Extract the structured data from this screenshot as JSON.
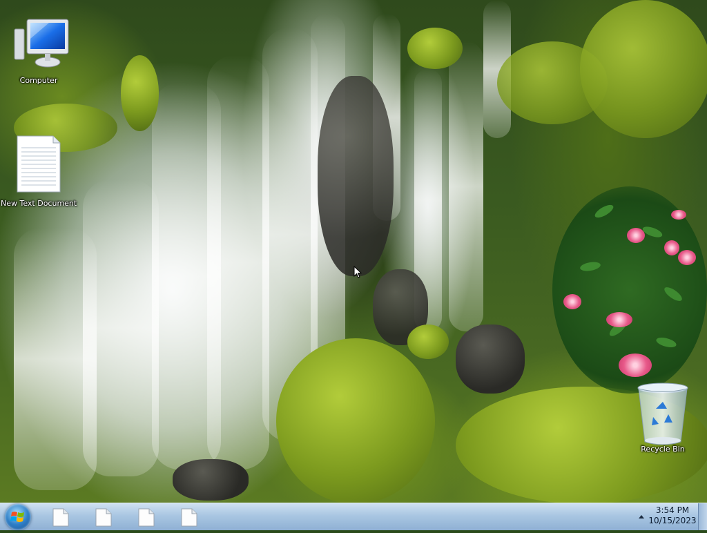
{
  "desktop": {
    "icons": [
      {
        "label": "Computer",
        "icon": "computer-icon"
      },
      {
        "label": "New Text Document",
        "icon": "text-document-icon"
      },
      {
        "label": "Recycle Bin",
        "icon": "recycle-bin-icon"
      }
    ]
  },
  "taskbar": {
    "start_button": {
      "icon": "windows-start-orb-icon"
    },
    "open_items": [
      {
        "icon": "document-icon"
      },
      {
        "icon": "document-icon"
      },
      {
        "icon": "document-icon"
      },
      {
        "icon": "document-icon"
      }
    ],
    "tray": {
      "show_hidden_icon": "triangle-up-icon",
      "time": "3:54 PM",
      "date": "10/15/2023"
    }
  }
}
